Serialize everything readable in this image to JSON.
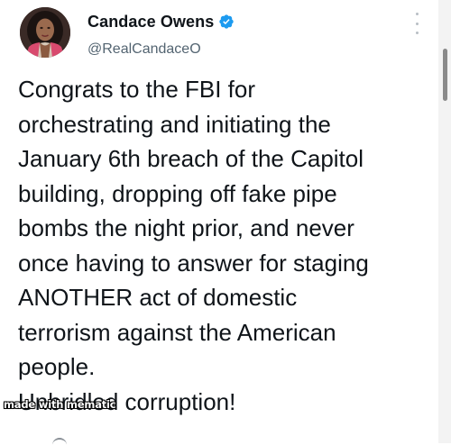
{
  "user": {
    "display_name": "Candace Owens",
    "handle": "@RealCandaceO",
    "verified": true,
    "avatar_icon": "profile-avatar"
  },
  "tweet": {
    "lines": [
      "Congrats to the FBI for",
      "orchestrating and initiating the",
      "January 6th breach of the Capitol",
      "building, dropping off fake pipe",
      "bombs the night prior, and never",
      "once having to answer for staging",
      "ANOTHER act of domestic",
      "terrorism against the American",
      "people.",
      "Unbridled corruption!"
    ]
  },
  "watermark": {
    "text": "made with mematic"
  },
  "icons": {
    "verified": "verified-badge-icon",
    "more": "more-options-icon"
  },
  "colors": {
    "verified_blue": "#1d9bf0",
    "text_primary": "#0f1419",
    "text_secondary": "#536471"
  }
}
